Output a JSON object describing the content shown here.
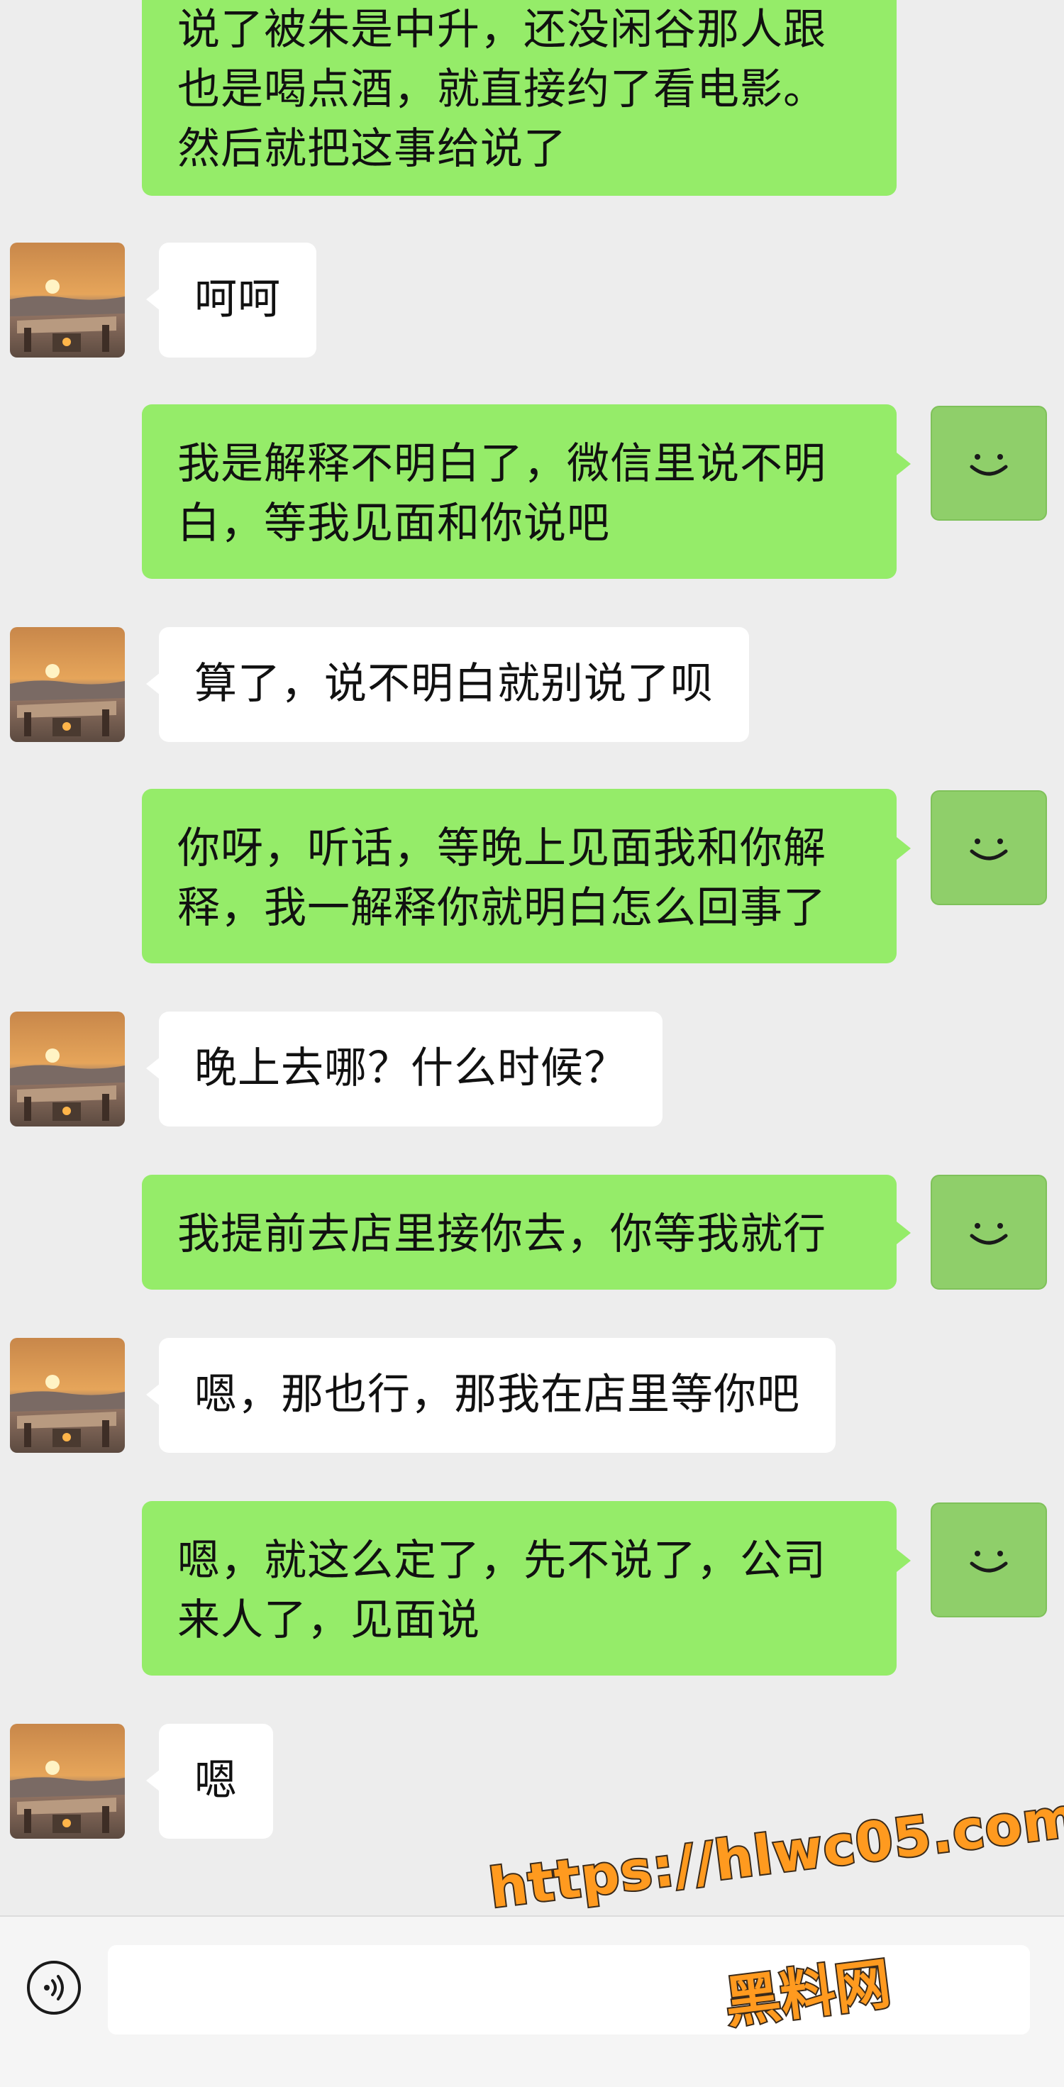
{
  "messages": [
    {
      "from": "me",
      "text": "说了被朱是中升，还没闲谷那人跟\n也是喝点酒，就直接约了看电影。\n然后就把这事给说了"
    },
    {
      "from": "contact",
      "text": "呵呵"
    },
    {
      "from": "me",
      "text": "我是解释不明白了，微信里说不明\n白，等我见面和你说吧"
    },
    {
      "from": "contact",
      "text": "算了，说不明白就别说了呗"
    },
    {
      "from": "me",
      "text": "你呀，听话，等晚上见面我和你解\n释，我一解释你就明白怎么回事了"
    },
    {
      "from": "contact",
      "text": "晚上去哪？什么时候？"
    },
    {
      "from": "me",
      "text": "我提前去店里接你去，你等我就行"
    },
    {
      "from": "contact",
      "text": "嗯，那也行，那我在店里等你吧"
    },
    {
      "from": "me",
      "text": "嗯，就这么定了，先不说了，公司\n来人了，见面说"
    },
    {
      "from": "contact",
      "text": "嗯"
    }
  ],
  "avatars": {
    "contact_icon": "sunset-photo-avatar",
    "me_icon": "smiley-face-avatar"
  },
  "input_bar": {
    "voice_icon": "voice-wave-icon",
    "text_value": ""
  },
  "watermark": {
    "url": "https://hlwc05.com",
    "name": "黑料网"
  },
  "colors": {
    "background": "#ededed",
    "outgoing_bubble": "#95ec69",
    "incoming_bubble": "#ffffff",
    "watermark": "#ff9a1f"
  }
}
